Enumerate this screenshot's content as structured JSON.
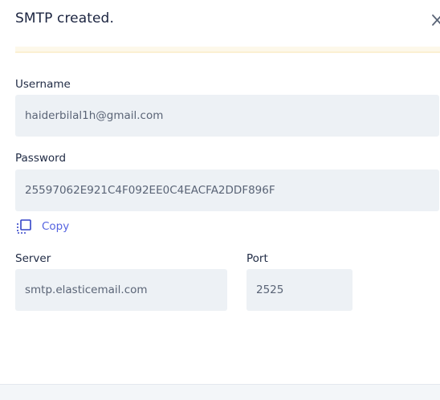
{
  "header": {
    "title": "SMTP created.",
    "close_icon": "close-icon"
  },
  "form": {
    "username": {
      "label": "Username",
      "value": "haiderbilal1h@gmail.com"
    },
    "password": {
      "label": "Password",
      "value": "25597062E921C4F092EE0C4EACFA2DDF896F"
    },
    "copy": {
      "label": "Copy",
      "icon": "copy-icon"
    },
    "server": {
      "label": "Server",
      "value": "smtp.elasticemail.com"
    },
    "port": {
      "label": "Port",
      "value": "2525"
    }
  },
  "colors": {
    "accent": "#5563e0",
    "field_bg": "#edf1f5",
    "banner_bg": "#fdf8ea"
  }
}
